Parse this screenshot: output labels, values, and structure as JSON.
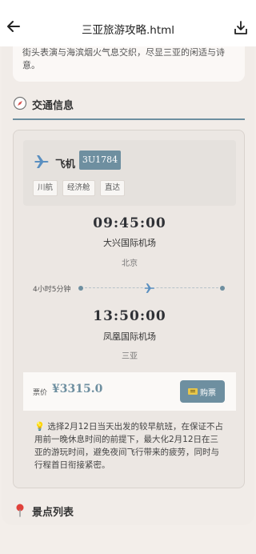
{
  "topbar": {
    "back_icon": "arrow-left-icon",
    "title": "三亚旅游攻略.html",
    "download_icon": "download-icon"
  },
  "intro": {
    "text": "街头表演与海滨烟火气息交织，尽显三亚的闲适与诗意。"
  },
  "transport_section": {
    "icon": "compass-icon",
    "title": "交通信息"
  },
  "flight": {
    "type_icon": "airplane-icon",
    "type": "飞机",
    "number": "3U1784",
    "tags": [
      "川航",
      "经济舱",
      "直达"
    ],
    "departure": {
      "time": "09:45:00",
      "airport": "大兴国际机场",
      "city": "北京"
    },
    "duration": "4小时5分钟",
    "arrival": {
      "time": "13:50:00",
      "airport": "凤凰国际机场",
      "city": "三亚"
    },
    "price_label": "票价",
    "price": "¥3315.0",
    "buy_label": "购票",
    "tip": "选择2月12日当天出发的较早航班，在保证不占用前一晚休息时间的前提下，最大化2月12日在三亚的游玩时间，避免夜间飞行带来的疲劳，同时与行程首日衔接紧密。",
    "tip_icon": "lightbulb-icon"
  },
  "attractions_section": {
    "icon": "map-pin-icon",
    "title": "景点列表"
  },
  "colors": {
    "accent": "#6e8fa0",
    "background": "#f3eeea"
  }
}
